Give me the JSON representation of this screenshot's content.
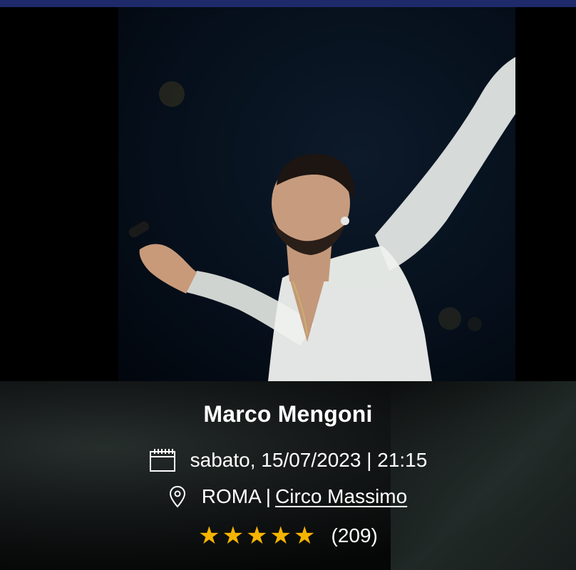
{
  "event": {
    "title": "Marco Mengoni",
    "date_text": "sabato, 15/07/2023 | 21:15",
    "city": "ROMA",
    "separator": "|",
    "venue": "Circo Massimo",
    "rating": 5,
    "rating_count": "(209)"
  },
  "icons": {
    "date": "calendar-icon",
    "location": "map-pin-icon",
    "rating": "star-icon"
  },
  "colors": {
    "top_bar": "#1f2a6b",
    "star": "#f5b400",
    "text": "#ffffff"
  }
}
